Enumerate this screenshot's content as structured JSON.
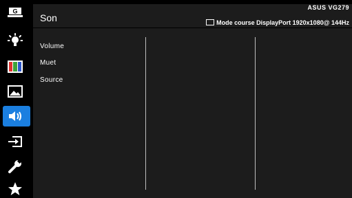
{
  "header": {
    "title": "Son",
    "model": "ASUS VG279",
    "mode": "Mode course DisplayPort 1920x1080@ 144Hz"
  },
  "menu": {
    "items": [
      {
        "label": "Volume"
      },
      {
        "label": "Muet"
      },
      {
        "label": "Source"
      }
    ]
  },
  "sidebar": {
    "items": [
      {
        "icon": "gameplus-icon",
        "label": "G"
      },
      {
        "icon": "splendid-icon"
      },
      {
        "icon": "color-icon"
      },
      {
        "icon": "image-icon"
      },
      {
        "icon": "sound-icon",
        "active": true
      },
      {
        "icon": "input-select-icon"
      },
      {
        "icon": "system-setup-icon"
      },
      {
        "icon": "shortcut-icon"
      }
    ]
  },
  "colors": {
    "accent": "#1b7fe0",
    "panel": "#1c1c1c",
    "background": "#000000"
  }
}
